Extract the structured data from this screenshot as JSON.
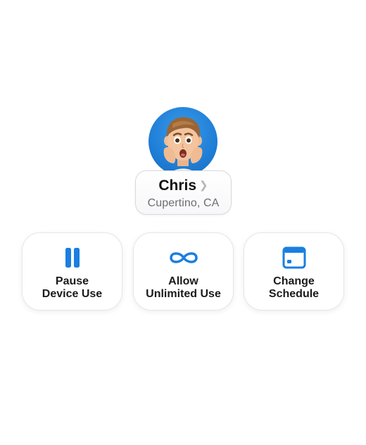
{
  "profile": {
    "name": "Chris",
    "location": "Cupertino, CA",
    "avatar_icon": "memoji-avatar",
    "chevron_icon": "chevron-right-icon"
  },
  "actions": [
    {
      "line1": "Pause",
      "line2": "Device Use",
      "icon": "pause-icon"
    },
    {
      "line1": "Allow",
      "line2": "Unlimited Use",
      "icon": "infinity-icon"
    },
    {
      "line1": "Change",
      "line2": "Schedule",
      "icon": "calendar-icon"
    }
  ],
  "colors": {
    "accent": "#1a7fe0",
    "avatar_background": "#1f7ed6",
    "text_primary": "#111111",
    "text_secondary": "#6d6d72"
  }
}
